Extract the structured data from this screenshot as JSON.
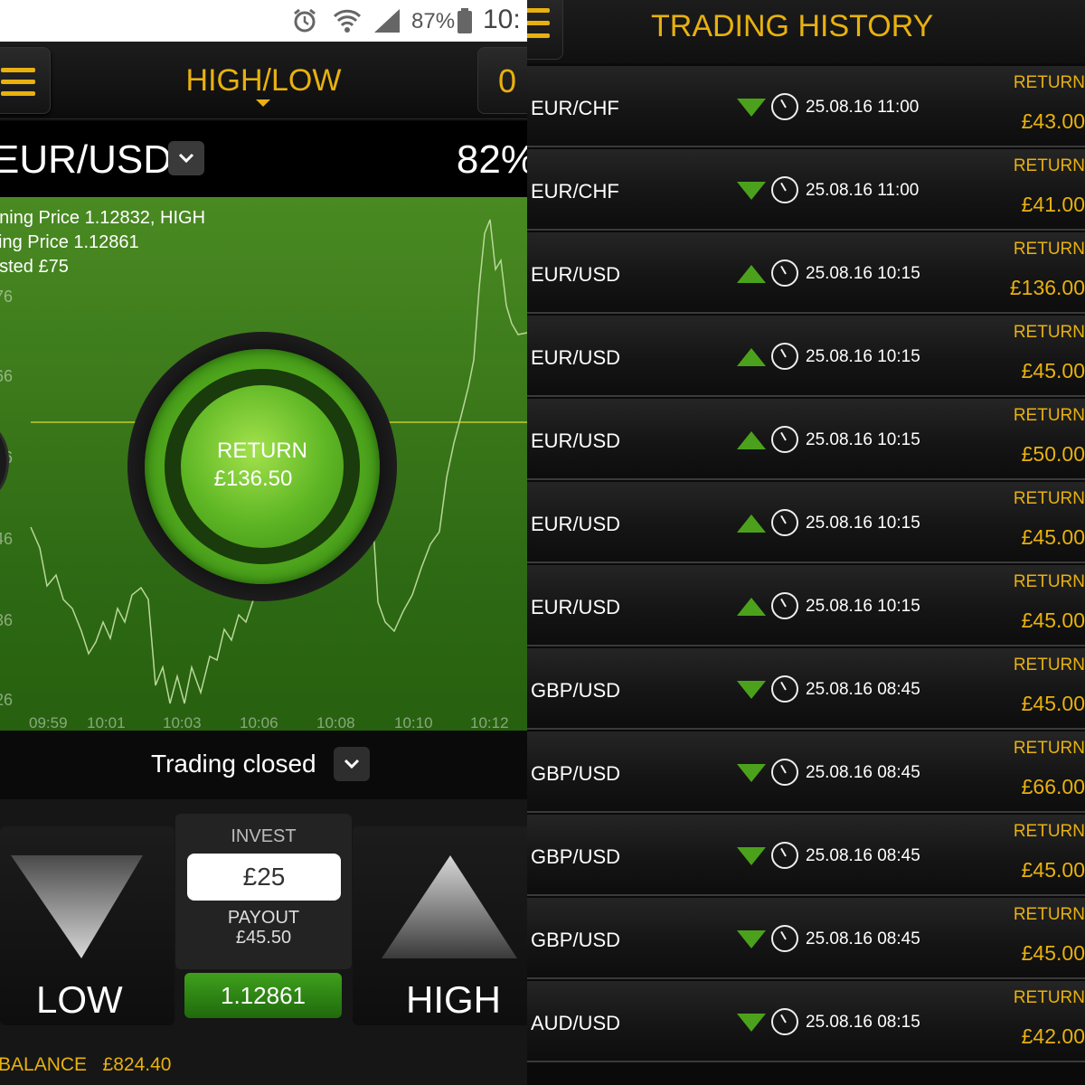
{
  "status": {
    "battery": "87%",
    "time": "10:"
  },
  "left": {
    "mode_title": "HIGH/LOW",
    "count": "0",
    "asset": "EUR/USD",
    "payout_pct": "82%",
    "info": [
      "ening Price 1.12832, HIGH",
      "sing Price 1.12861",
      "ested £75"
    ],
    "y_ticks": [
      "76",
      "66",
      "56",
      "46",
      "36",
      "26"
    ],
    "x_ticks": [
      "09:59",
      "10:01",
      "10:03",
      "10:06",
      "10:08",
      "10:10",
      "10:12"
    ],
    "return_label": "RETURN",
    "return_value": "£136.50",
    "trading_status": "Trading closed",
    "invest_label": "INVEST",
    "invest_value": "£25",
    "payout_label": "PAYOUT",
    "payout_value": "£45.50",
    "price": "1.12861",
    "low_label": "LOW",
    "high_label": "HIGH",
    "balance": "BALANCE   £824.40"
  },
  "right": {
    "title": "TRADING HISTORY",
    "return_label": "RETURN",
    "rows": [
      {
        "pair": "EUR/CHF",
        "dir": "down",
        "dt": "25.08.16 11:00",
        "amount": "£43.00"
      },
      {
        "pair": "EUR/CHF",
        "dir": "down",
        "dt": "25.08.16 11:00",
        "amount": "£41.00"
      },
      {
        "pair": "EUR/USD",
        "dir": "up",
        "dt": "25.08.16 10:15",
        "amount": "£136.00"
      },
      {
        "pair": "EUR/USD",
        "dir": "up",
        "dt": "25.08.16 10:15",
        "amount": "£45.00"
      },
      {
        "pair": "EUR/USD",
        "dir": "up",
        "dt": "25.08.16 10:15",
        "amount": "£50.00"
      },
      {
        "pair": "EUR/USD",
        "dir": "up",
        "dt": "25.08.16 10:15",
        "amount": "£45.00"
      },
      {
        "pair": "EUR/USD",
        "dir": "up",
        "dt": "25.08.16 10:15",
        "amount": "£45.00"
      },
      {
        "pair": "GBP/USD",
        "dir": "down",
        "dt": "25.08.16 08:45",
        "amount": "£45.00"
      },
      {
        "pair": "GBP/USD",
        "dir": "down",
        "dt": "25.08.16 08:45",
        "amount": "£66.00"
      },
      {
        "pair": "GBP/USD",
        "dir": "down",
        "dt": "25.08.16 08:45",
        "amount": "£45.00"
      },
      {
        "pair": "GBP/USD",
        "dir": "down",
        "dt": "25.08.16 08:45",
        "amount": "£45.00"
      },
      {
        "pair": "AUD/USD",
        "dir": "down",
        "dt": "25.08.16 08:15",
        "amount": "£42.00"
      }
    ]
  },
  "colors": {
    "accent": "#e8b10f",
    "green": "#4ca11c",
    "chart_bg": "#3a7a1a"
  }
}
